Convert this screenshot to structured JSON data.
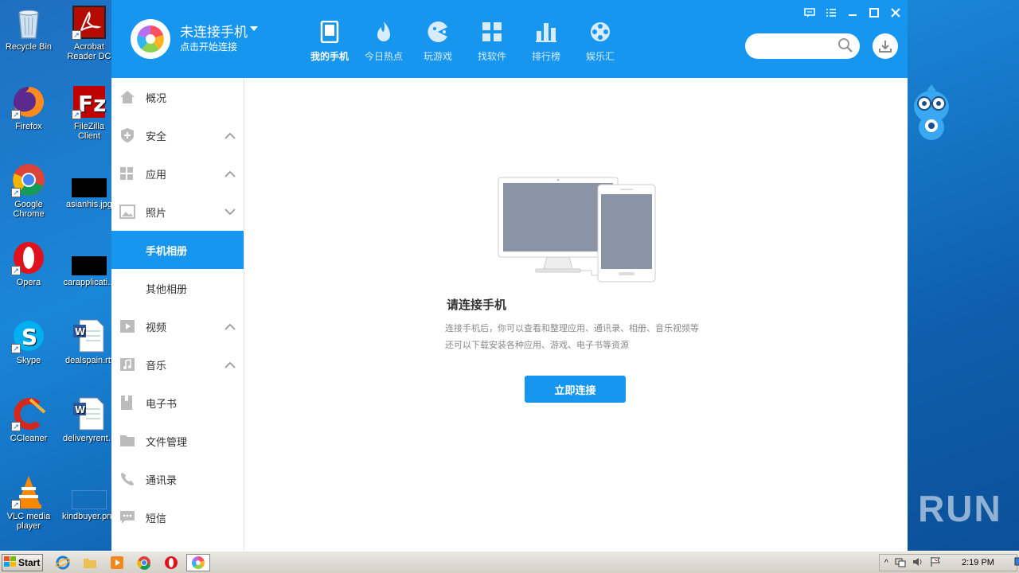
{
  "desktop": {
    "icons": [
      {
        "label": "Recycle Bin",
        "icon": "recycle-bin-icon"
      },
      {
        "label": "Acrobat Reader DC",
        "icon": "acrobat-icon"
      },
      {
        "label": "Firefox",
        "icon": "firefox-icon"
      },
      {
        "label": "FileZilla Client",
        "icon": "filezilla-icon"
      },
      {
        "label": "Google Chrome",
        "icon": "chrome-icon"
      },
      {
        "label": "asianhis.jpg",
        "icon": "image-file-icon"
      },
      {
        "label": "Opera",
        "icon": "opera-icon"
      },
      {
        "label": "carapplicati...",
        "icon": "image-file-icon"
      },
      {
        "label": "Skype",
        "icon": "skype-icon"
      },
      {
        "label": "dealspain.rtf",
        "icon": "word-doc-icon"
      },
      {
        "label": "CCleaner",
        "icon": "ccleaner-icon"
      },
      {
        "label": "deliveryrent...",
        "icon": "word-doc-icon"
      },
      {
        "label": "VLC media player",
        "icon": "vlc-icon"
      },
      {
        "label": "kindbuyer.png",
        "icon": "image-file-icon"
      }
    ],
    "watermark": "ANY RUN"
  },
  "app": {
    "status_title": "未连接手机",
    "status_sub": "点击开始连接",
    "nav": [
      {
        "label": "我的手机",
        "icon": "phone-icon"
      },
      {
        "label": "今日热点",
        "icon": "flame-icon"
      },
      {
        "label": "玩游戏",
        "icon": "game-icon"
      },
      {
        "label": "找软件",
        "icon": "apps-grid-icon"
      },
      {
        "label": "排行榜",
        "icon": "ranking-bars-icon"
      },
      {
        "label": "娱乐汇",
        "icon": "film-reel-icon"
      }
    ],
    "search_placeholder": "",
    "sidebar": [
      {
        "label": "概况",
        "icon": "home-icon",
        "chevron": ""
      },
      {
        "label": "安全",
        "icon": "shield-icon",
        "chevron": "up"
      },
      {
        "label": "应用",
        "icon": "apps-icon",
        "chevron": "up"
      },
      {
        "label": "照片",
        "icon": "photo-icon",
        "chevron": "down"
      },
      {
        "label": "手机相册",
        "icon": "",
        "chevron": "",
        "sub": true,
        "active": true
      },
      {
        "label": "其他相册",
        "icon": "",
        "chevron": "",
        "sub": true
      },
      {
        "label": "视频",
        "icon": "video-icon",
        "chevron": "up"
      },
      {
        "label": "音乐",
        "icon": "music-icon",
        "chevron": "up"
      },
      {
        "label": "电子书",
        "icon": "book-icon",
        "chevron": ""
      },
      {
        "label": "文件管理",
        "icon": "folder-icon",
        "chevron": ""
      },
      {
        "label": "通讯录",
        "icon": "contacts-icon",
        "chevron": ""
      },
      {
        "label": "短信",
        "icon": "sms-icon",
        "chevron": ""
      }
    ],
    "main": {
      "title": "请连接手机",
      "desc_line1": "连接手机后，你可以查看和整理应用、通讯录、相册、音乐视频等",
      "desc_line2": "还可以下载安装各种应用、游戏、电子书等资源",
      "button": "立即连接"
    }
  },
  "taskbar": {
    "start": "Start",
    "clock": "2:19 PM"
  },
  "colors": {
    "brand_blue": "#1696ee",
    "sidebar_text": "#333333",
    "desc_text": "#888888"
  }
}
